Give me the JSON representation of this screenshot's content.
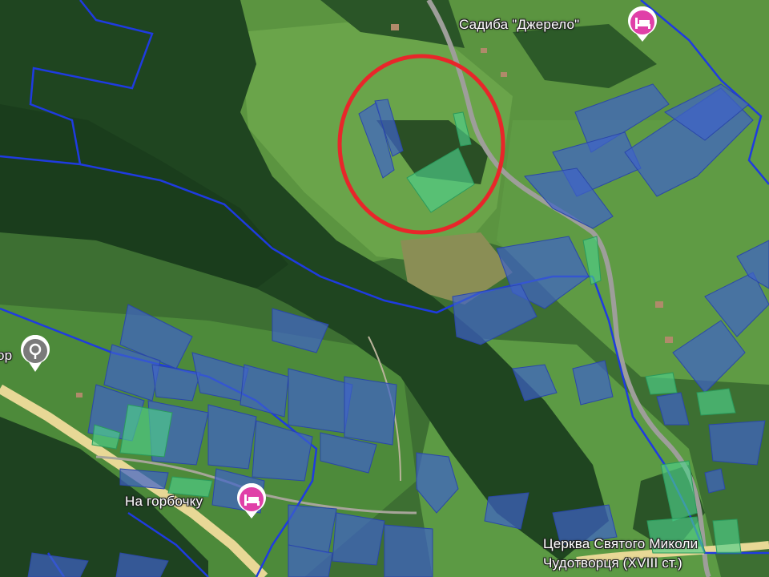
{
  "map": {
    "view": "satellite",
    "highlight_circle_color": "#e8262a",
    "parcel_color_blue": "#3f63c9",
    "parcel_color_green": "#4fcf8a",
    "boundary_line_color": "#1f3be0"
  },
  "places": [
    {
      "name": "Садиба \"Джерело\"",
      "icon": "hotel-bed-icon",
      "icon_color": "#e040a8"
    },
    {
      "name": "На горбочку",
      "icon": "hotel-bed-icon",
      "icon_color": "#e040a8"
    },
    {
      "name": "Церква Святого Миколи",
      "icon": "none"
    },
    {
      "name": "Чудотворця (XVIII ст.)",
      "icon": "none"
    },
    {
      "name": "ор",
      "icon": "location-pin-icon",
      "icon_color": "#7a7a7a"
    }
  ]
}
